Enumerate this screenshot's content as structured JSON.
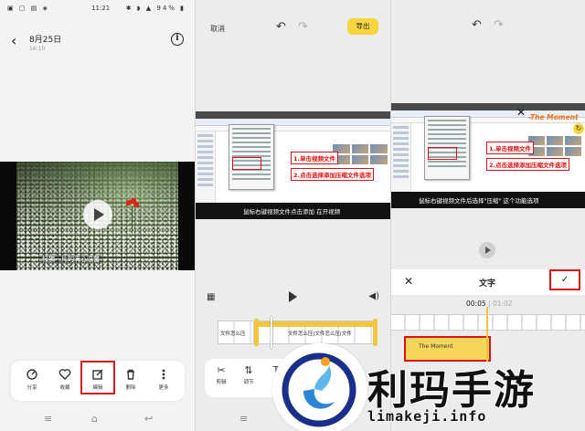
{
  "panel1": {
    "status": {
      "left": "▣ ▢ ▤ ◈",
      "time": "11:21",
      "right": "✱ ◗ ▲ 94% ▮"
    },
    "date": "8月25日",
    "subdate": "16:10",
    "caption": "轻拂一片的满心温馨",
    "actions": [
      {
        "label": "分享",
        "icon": "share-icon"
      },
      {
        "label": "收藏",
        "icon": "heart-icon"
      },
      {
        "label": "编辑",
        "icon": "edit-icon"
      },
      {
        "label": "删除",
        "icon": "trash-icon"
      },
      {
        "label": "更多",
        "icon": "more-icon"
      }
    ]
  },
  "panel2": {
    "cancel": "取消",
    "export": "导出",
    "callout1": "1.单击视频文件",
    "callout2": "2.点击选择添加压缩文件选项",
    "subtitle": "鼠标右键视频文件点击添加 在开视频",
    "clip_text_a": "文件怎么压",
    "clip_text_b": "文件怎么压|文件怎么压|文件",
    "tools": [
      {
        "label": "剪辑",
        "icon": "scissors-icon"
      },
      {
        "label": "调节",
        "icon": "adjust-icon"
      },
      {
        "label": "文",
        "icon": "text-icon"
      }
    ]
  },
  "panel3": {
    "moment_text": "-The Moment",
    "callout1": "1.单击视频文件",
    "callout2": "2.点击选择添加压缩文件选项",
    "subtitle": "鼠标右键视频文件后选择\"压缩\" 这个功能选项",
    "title": "文字",
    "confirm": "✓",
    "time_current": "00:05",
    "time_total": "01:02",
    "text_clip": "The Moment"
  },
  "watermark": {
    "brand": "利玛手游",
    "url": "limakeji.info"
  },
  "colors": {
    "accent_yellow": "#f7d53f",
    "highlight_red": "#d31e1e",
    "moment_orange": "#e87316"
  }
}
